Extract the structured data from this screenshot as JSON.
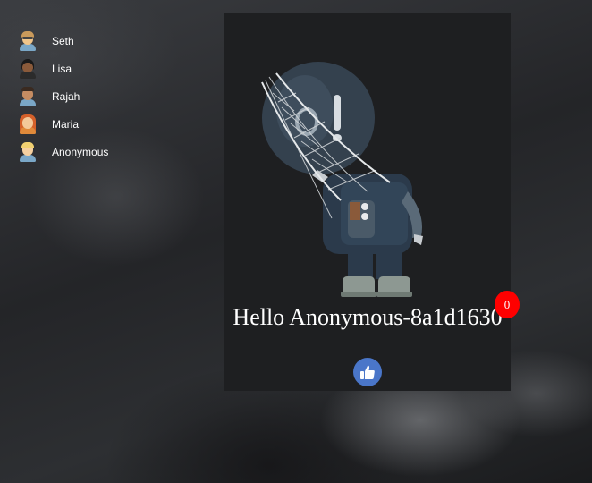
{
  "users": [
    {
      "name": "Seth",
      "avatar": "man-with-glasses-emoji"
    },
    {
      "name": "Lisa",
      "avatar": "dark-skin-woman-emoji"
    },
    {
      "name": "Rajah",
      "avatar": "medium-skin-man-emoji"
    },
    {
      "name": "Maria",
      "avatar": "red-hair-woman-emoji"
    },
    {
      "name": "Anonymous",
      "avatar": "blond-person-emoji"
    }
  ],
  "card": {
    "greeting": "Hello Anonymous-8a1d1630",
    "illustration": "astronaut-caught-in-net",
    "like_icon": "thumbs-up-icon"
  },
  "like_count": "0",
  "colors": {
    "like_button": "#4a76c9",
    "count_badge": "#ff0000",
    "card_background": "#1e1f21"
  }
}
